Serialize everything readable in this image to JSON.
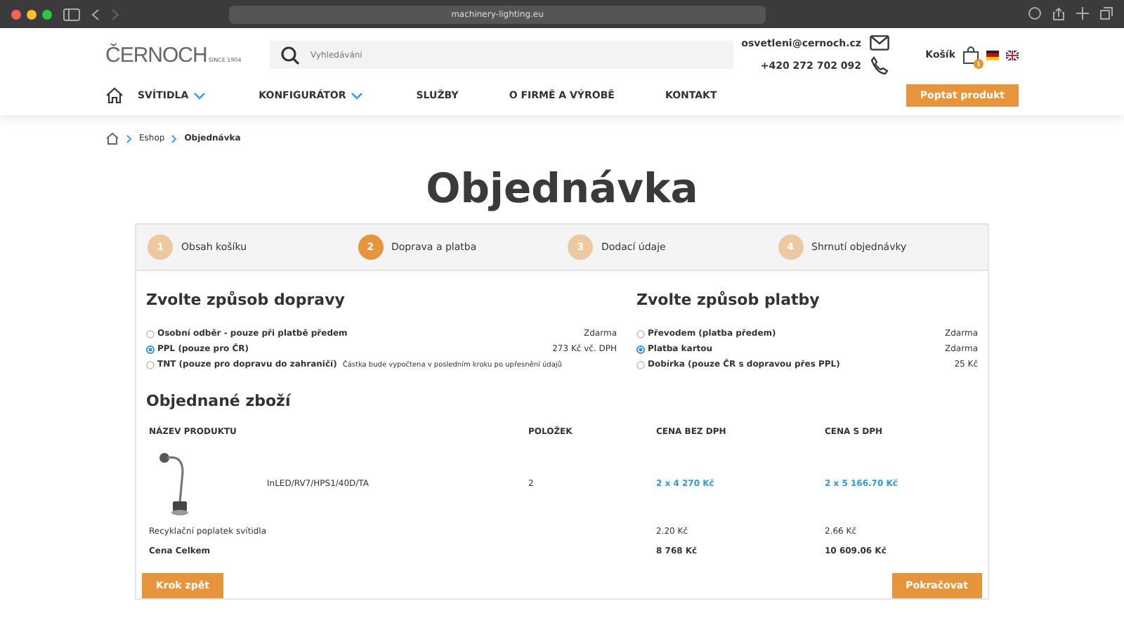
{
  "browser": {
    "url": "machinery-lighting.eu"
  },
  "header": {
    "logo": "ČERNOCH",
    "logo_tagline": "SINCE 1904",
    "search": {
      "placeholder": "Vyhledávání"
    },
    "email": "osvetleni@cernoch.cz",
    "phone": "+420 272 702 092",
    "cart_label": "Košík",
    "cart_count": "1",
    "cta": "Poptat produkt"
  },
  "nav": [
    {
      "label": "SVÍTIDLA",
      "dropdown": true
    },
    {
      "label": "KONFIGURÁTOR",
      "dropdown": true
    },
    {
      "label": "SLUŽBY",
      "dropdown": false
    },
    {
      "label": "O FIRMĚ A VÝROBĚ",
      "dropdown": false
    },
    {
      "label": "KONTAKT",
      "dropdown": false
    }
  ],
  "breadcrumb": [
    "Eshop",
    "Objednávka"
  ],
  "title": "Objednávka",
  "steps": [
    {
      "number": "1",
      "label": "Obsah košíku",
      "selected": false
    },
    {
      "number": "2",
      "label": "Doprava a platba",
      "selected": true
    },
    {
      "number": "3",
      "label": "Dodací údaje",
      "selected": false
    },
    {
      "number": "4",
      "label": "Shrnutí objednávky",
      "selected": false
    }
  ],
  "shipping": {
    "title": "Zvolte způsob dopravy",
    "options": [
      {
        "label": "Osobní odběr - pouze při platbě předem",
        "price": "Zdarma",
        "selected": false
      },
      {
        "label": "PPL (pouze pro ČR)",
        "price": "273 Kč vč. DPH",
        "selected": true
      },
      {
        "label": "TNT (pouze pro dopravu do zahraničí)",
        "note": "Částka bude vypočtena v posledním kroku po upřesnění údajů",
        "selected": false
      }
    ]
  },
  "payment": {
    "title": "Zvolte způsob platby",
    "options": [
      {
        "label": "Převodem (platba předem)",
        "price": "Zdarma",
        "selected": false
      },
      {
        "label": "Platba kartou",
        "price": "Zdarma",
        "selected": true
      },
      {
        "label": "Dobírka (pouze ČR s dopravou přes PPL)",
        "price": "25 Kč",
        "selected": false
      }
    ]
  },
  "order": {
    "title": "Objednané zboží",
    "columns": [
      "NÁZEV PRODUKTU",
      "POLOŽEK",
      "CENA BEZ DPH",
      "CENA S DPH"
    ],
    "product": {
      "name": "InLED/RV7/HPS1/40D/TA",
      "quantity": "2",
      "price_net": "2 x 4 270 Kč",
      "price_gross": "2 x 5 166.70 Kč"
    },
    "fee": {
      "label": "Recyklační poplatek svítidla",
      "price_net": "2.20 Kč",
      "price_gross": "2.66 Kč"
    },
    "total": {
      "label": "Cena Celkem",
      "price_net": "8 768 Kč",
      "price_gross": "10 609.06 Kč"
    }
  },
  "buttons": {
    "back": "Krok zpět",
    "next": "Pokračovat"
  }
}
